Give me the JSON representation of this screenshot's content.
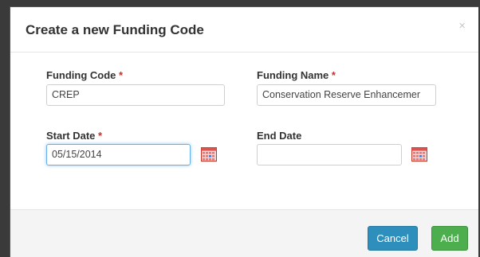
{
  "dialog": {
    "title": "Create a new Funding Code",
    "close_label": "×"
  },
  "form": {
    "funding_code": {
      "label": "Funding Code",
      "required_mark": "*",
      "value": "CREP"
    },
    "funding_name": {
      "label": "Funding Name",
      "required_mark": "*",
      "value": "Conservation Reserve Enhancemer"
    },
    "start_date": {
      "label": "Start Date",
      "required_mark": "*",
      "value": "05/15/2014"
    },
    "end_date": {
      "label": "End Date",
      "value": ""
    }
  },
  "footer": {
    "cancel_label": "Cancel",
    "add_label": "Add"
  },
  "colors": {
    "cancel": "#2e8fbd",
    "add": "#4cae4c",
    "required": "#c9302c"
  },
  "icons": {
    "calendar": "calendar-icon"
  }
}
